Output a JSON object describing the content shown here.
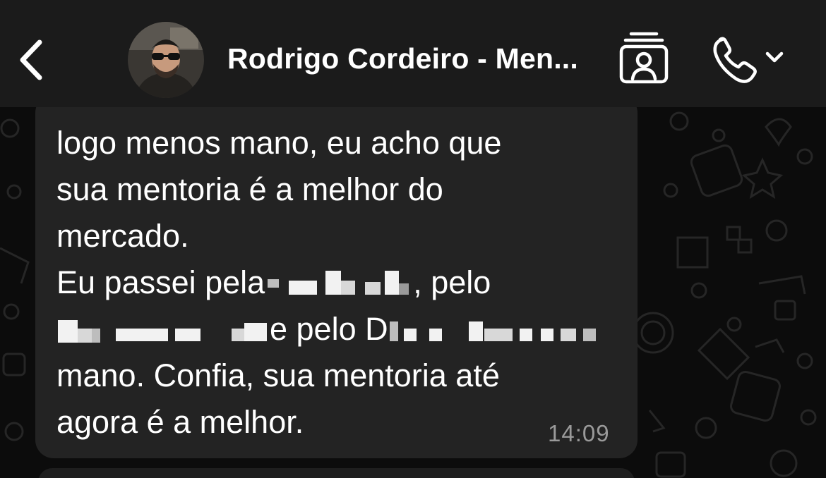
{
  "header": {
    "back_icon": "chevron-left-icon",
    "contact_name": "Rodrigo Cordeiro - Men...",
    "contact_card_icon": "contact-card-icon",
    "call_icon": "phone-icon",
    "call_dropdown_icon": "chevron-down-icon"
  },
  "message": {
    "lines": {
      "l1": "logo menos mano, eu acho que",
      "l2": "sua mentoria é a melhor do",
      "l3": "mercado.",
      "l4_a": "Eu passei pela",
      "l4_b": ", pelo",
      "l5_b": "e pelo D",
      "l6": "mano. Confia, sua mentoria até",
      "l7": "agora é a melhor."
    },
    "time": "14:09"
  },
  "colors": {
    "header_bg": "#1b1b1b",
    "chat_bg": "#0c0c0c",
    "bubble_bg": "#232323",
    "text": "#ffffff",
    "timestamp": "#9a9a9a"
  }
}
